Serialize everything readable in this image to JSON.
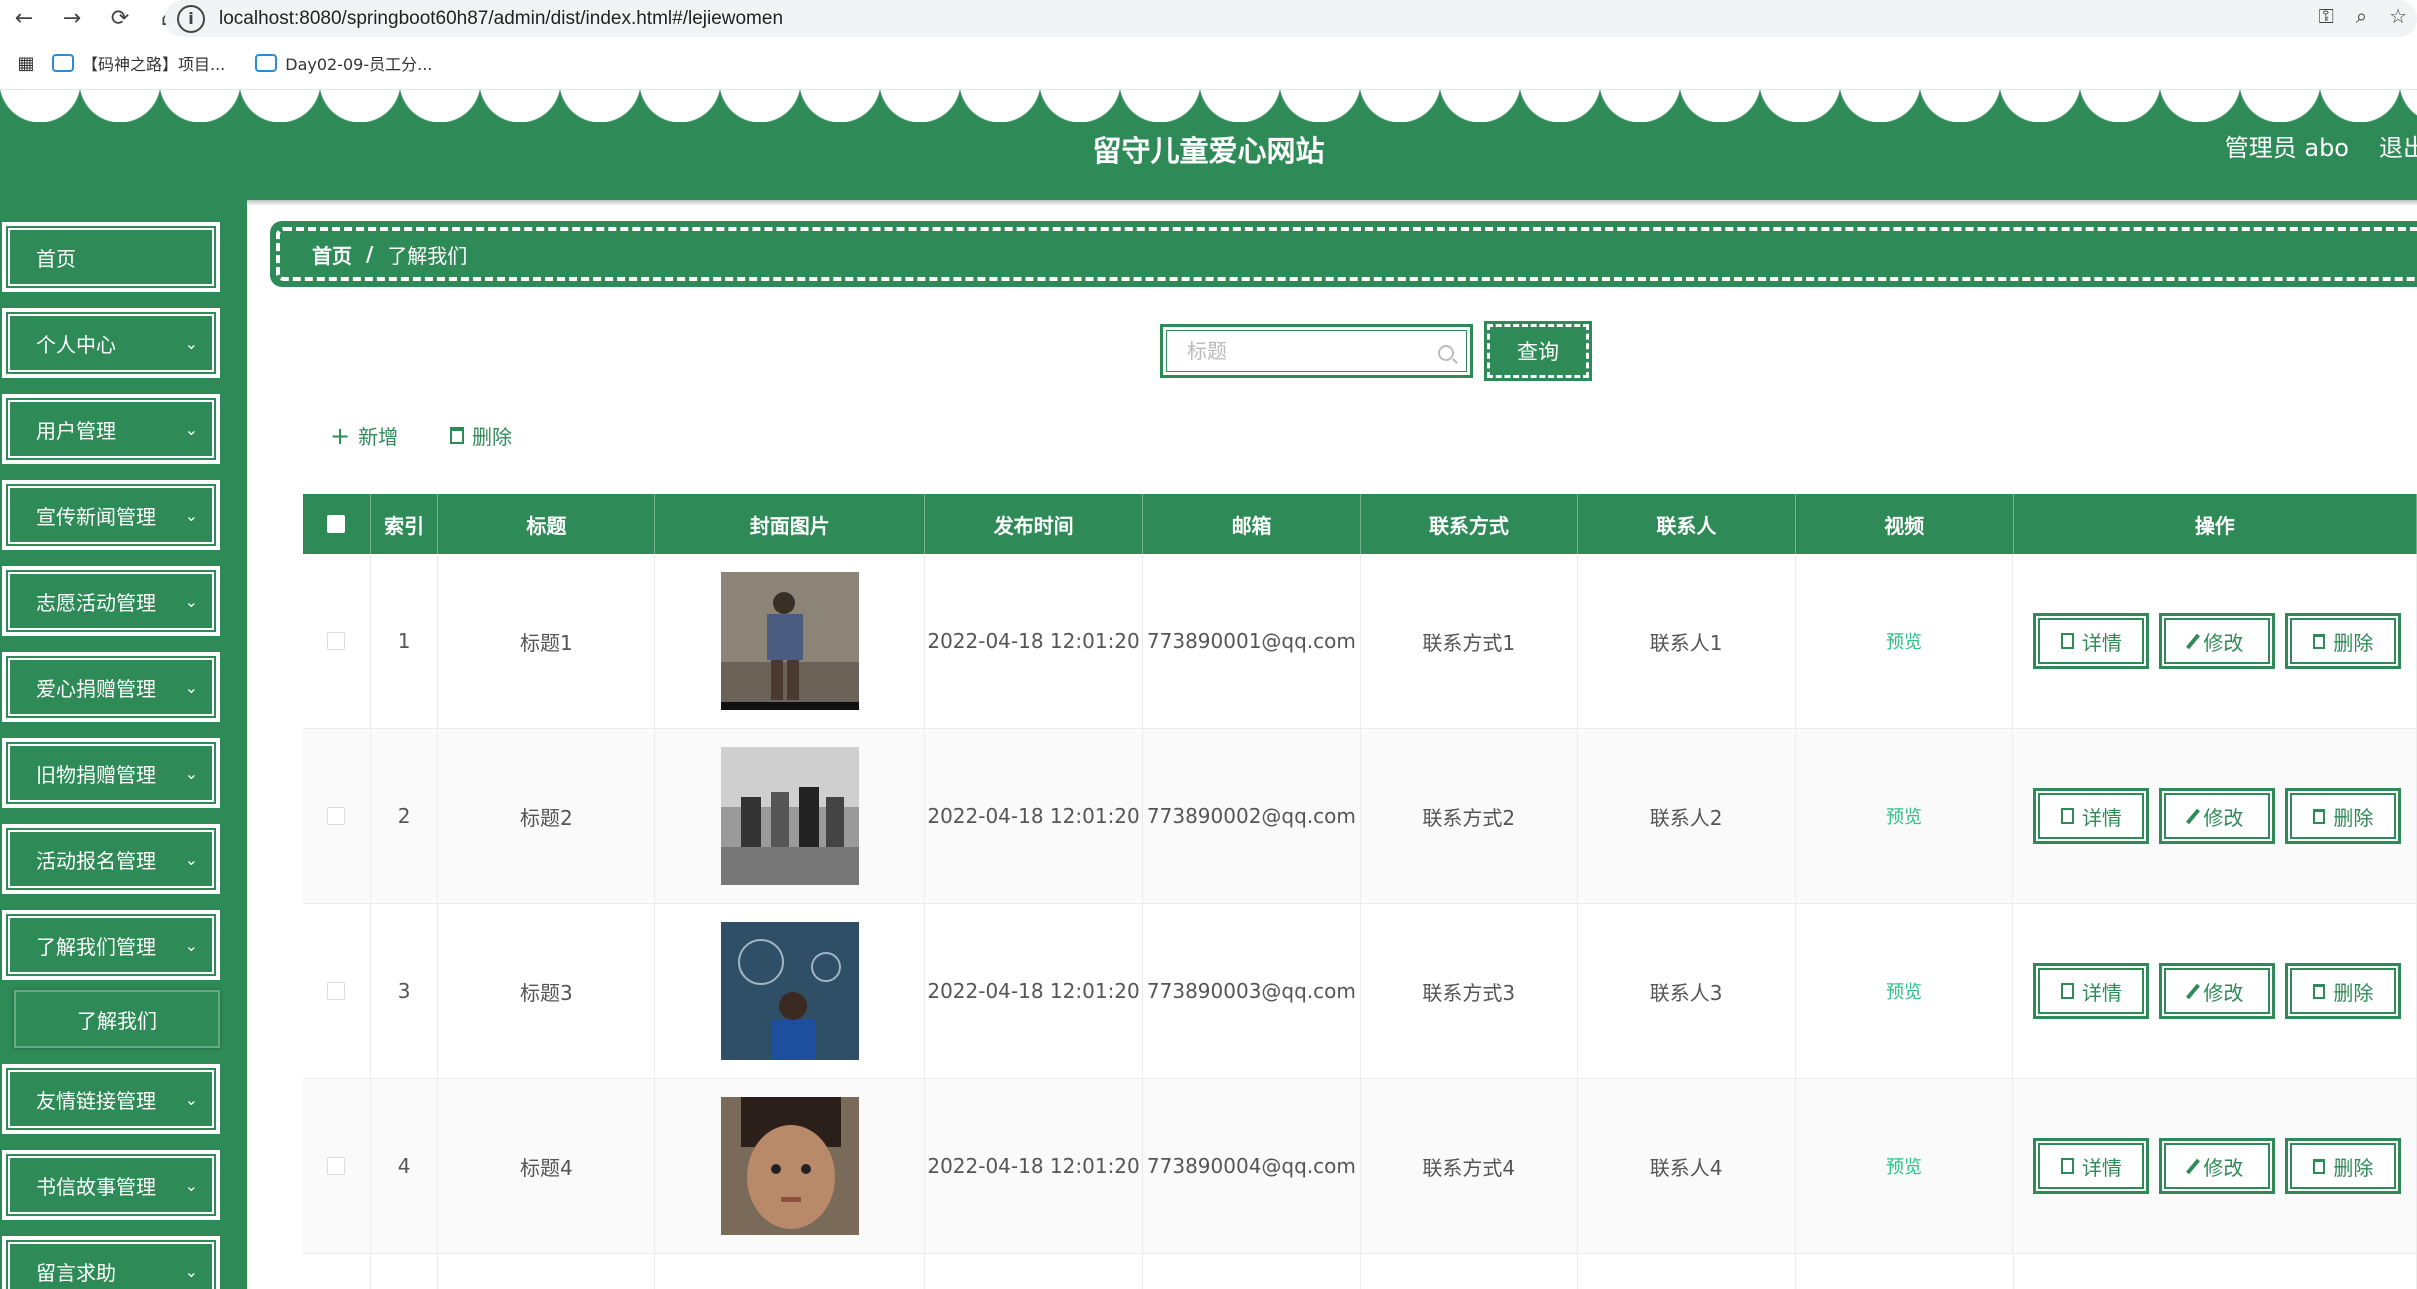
{
  "browser": {
    "url": "localhost:8080/springboot60h87/admin/dist/index.html#/lejiewomen",
    "bookmarks": [
      "【码神之路】项目...",
      "Day02-09-员工分..."
    ]
  },
  "header": {
    "title": "留守儿童爱心网站",
    "admin": "管理员 abo",
    "logout": "退出"
  },
  "sidebar": {
    "items": [
      {
        "label": "首页"
      },
      {
        "label": "个人中心"
      },
      {
        "label": "用户管理"
      },
      {
        "label": "宣传新闻管理"
      },
      {
        "label": "志愿活动管理"
      },
      {
        "label": "爱心捐赠管理"
      },
      {
        "label": "旧物捐赠管理"
      },
      {
        "label": "活动报名管理"
      },
      {
        "label": "了解我们管理"
      },
      {
        "label": "友情链接管理"
      },
      {
        "label": "书信故事管理"
      },
      {
        "label": "留言求助"
      }
    ],
    "sub_item": "了解我们"
  },
  "breadcrumb": {
    "home": "首页",
    "sep": "/",
    "current": "了解我们"
  },
  "search": {
    "placeholder": "标题",
    "button": "查询"
  },
  "actions": {
    "add": "新增",
    "delete": "删除"
  },
  "table": {
    "headers": [
      "索引",
      "标题",
      "封面图片",
      "发布时间",
      "邮箱",
      "联系方式",
      "联系人",
      "视频",
      "操作"
    ],
    "rows": [
      {
        "index": "1",
        "title": "标题1",
        "time": "2022-04-18 12:01:20",
        "email": "773890001@qq.com",
        "contact": "联系方式1",
        "person": "联系人1",
        "video": "预览"
      },
      {
        "index": "2",
        "title": "标题2",
        "time": "2022-04-18 12:01:20",
        "email": "773890002@qq.com",
        "contact": "联系方式2",
        "person": "联系人2",
        "video": "预览"
      },
      {
        "index": "3",
        "title": "标题3",
        "time": "2022-04-18 12:01:20",
        "email": "773890003@qq.com",
        "contact": "联系方式3",
        "person": "联系人3",
        "video": "预览"
      },
      {
        "index": "4",
        "title": "标题4",
        "time": "2022-04-18 12:01:20",
        "email": "773890004@qq.com",
        "contact": "联系方式4",
        "person": "联系人4",
        "video": "预览"
      }
    ],
    "ops": {
      "detail": "详情",
      "edit": "修改",
      "delete": "删除"
    }
  },
  "colors": {
    "primary": "#2e8b57",
    "link": "#2fbf8a"
  }
}
